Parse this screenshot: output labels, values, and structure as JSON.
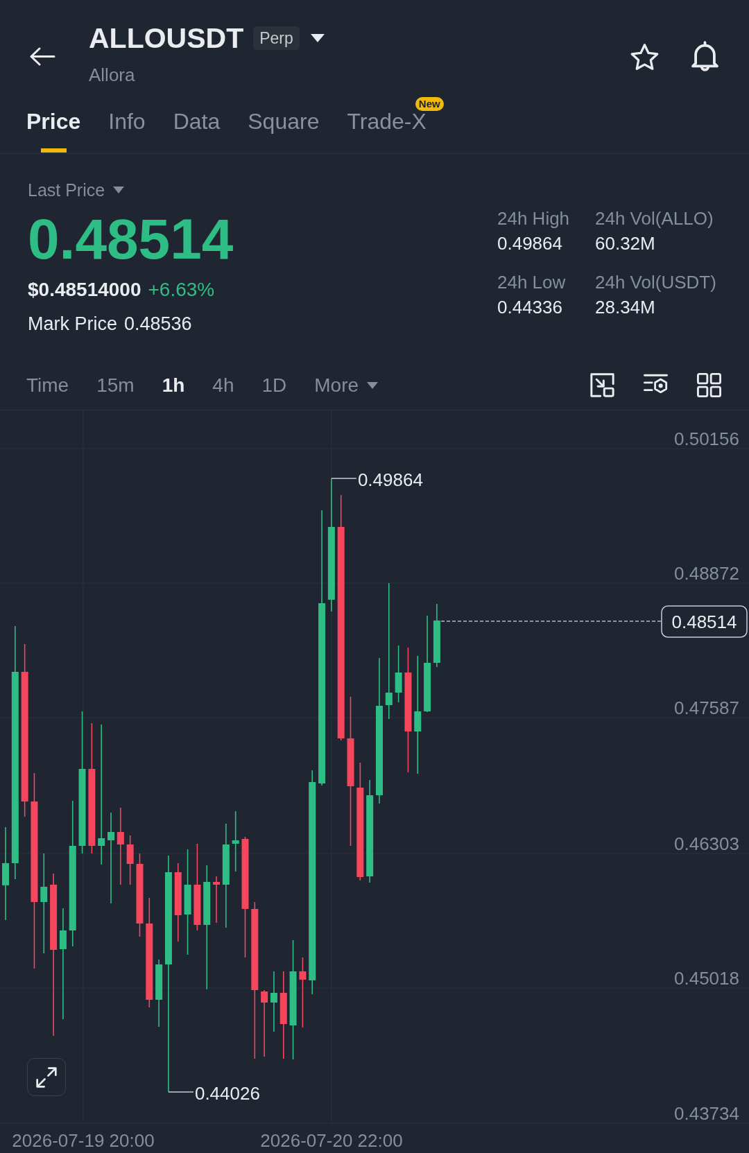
{
  "header": {
    "symbol": "ALLOUSDT",
    "badge": "Perp",
    "name": "Allora"
  },
  "tabs": [
    {
      "label": "Price",
      "selected": true
    },
    {
      "label": "Info",
      "selected": false
    },
    {
      "label": "Data",
      "selected": false
    },
    {
      "label": "Square",
      "selected": false
    },
    {
      "label": "Trade-X",
      "selected": false,
      "badge": "New"
    }
  ],
  "ticker": {
    "label": "Last Price",
    "price": "0.48514",
    "rising": true,
    "usd_price": "$0.48514000",
    "change": "+6.63%",
    "mark_label": "Mark Price",
    "mark_price": "0.48536"
  },
  "stats": [
    {
      "label": "24h High",
      "value": "0.49864"
    },
    {
      "label": "24h Vol(ALLO)",
      "value": "60.32M"
    },
    {
      "label": "24h Low",
      "value": "0.44336"
    },
    {
      "label": "24h Vol(USDT)",
      "value": "28.34M"
    }
  ],
  "intervals": [
    {
      "label": "Time",
      "kind": "option",
      "selected": false
    },
    {
      "label": "15m",
      "kind": "option",
      "selected": false
    },
    {
      "label": "1h",
      "kind": "option",
      "selected": true
    },
    {
      "label": "4h",
      "kind": "option",
      "selected": false
    },
    {
      "label": "1D",
      "kind": "option",
      "selected": false
    },
    {
      "label": "More",
      "kind": "menu",
      "selected": false
    }
  ],
  "chart": {
    "price_labels": [
      "0.50156",
      "0.48872",
      "0.47587",
      "0.46303",
      "0.45018",
      "0.43734"
    ],
    "time_labels": [
      "2026-07-19 20:00",
      "2026-07-20 22:00"
    ],
    "high_label": "0.49864",
    "low_label": "0.44026",
    "current_price": "0.48514"
  }
}
